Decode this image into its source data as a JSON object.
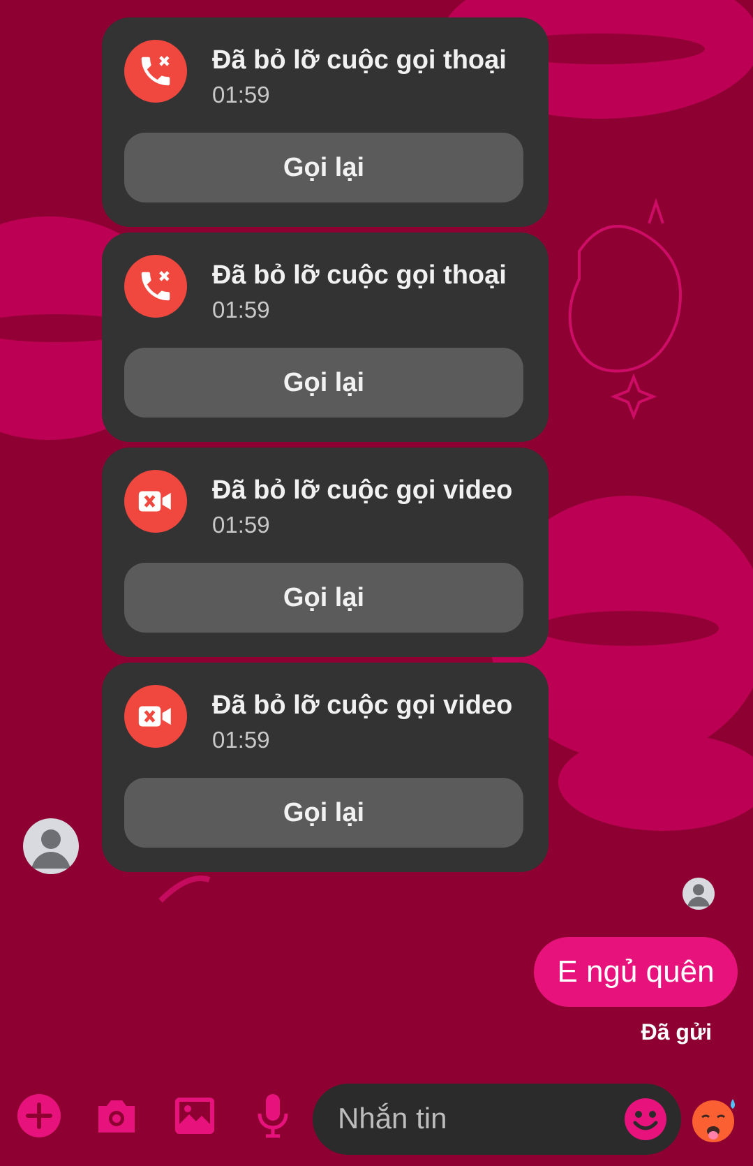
{
  "calls": [
    {
      "type": "voice",
      "title": "Đã bỏ lỡ cuộc gọi thoại",
      "time": "01:59",
      "button": "Gọi lại"
    },
    {
      "type": "voice",
      "title": "Đã bỏ lỡ cuộc gọi thoại",
      "time": "01:59",
      "button": "Gọi lại"
    },
    {
      "type": "video",
      "title": "Đã bỏ lỡ cuộc gọi video",
      "time": "01:59",
      "button": "Gọi lại"
    },
    {
      "type": "video",
      "title": "Đã bỏ lỡ cuộc gọi video",
      "time": "01:59",
      "button": "Gọi lại"
    }
  ],
  "my_message": {
    "text": "E ngủ quên",
    "status": "Đã gửi"
  },
  "composer": {
    "placeholder": "Nhắn tin"
  },
  "toolbar": {
    "icons": [
      "plus-icon",
      "camera-icon",
      "image-icon",
      "microphone-icon",
      "smiley-icon",
      "hot-face-emoji"
    ]
  },
  "colors": {
    "background": "#8e0032",
    "accent": "#e8127c",
    "card": "#333333",
    "button": "#5b5b5b",
    "missed_icon": "#f0483e"
  }
}
